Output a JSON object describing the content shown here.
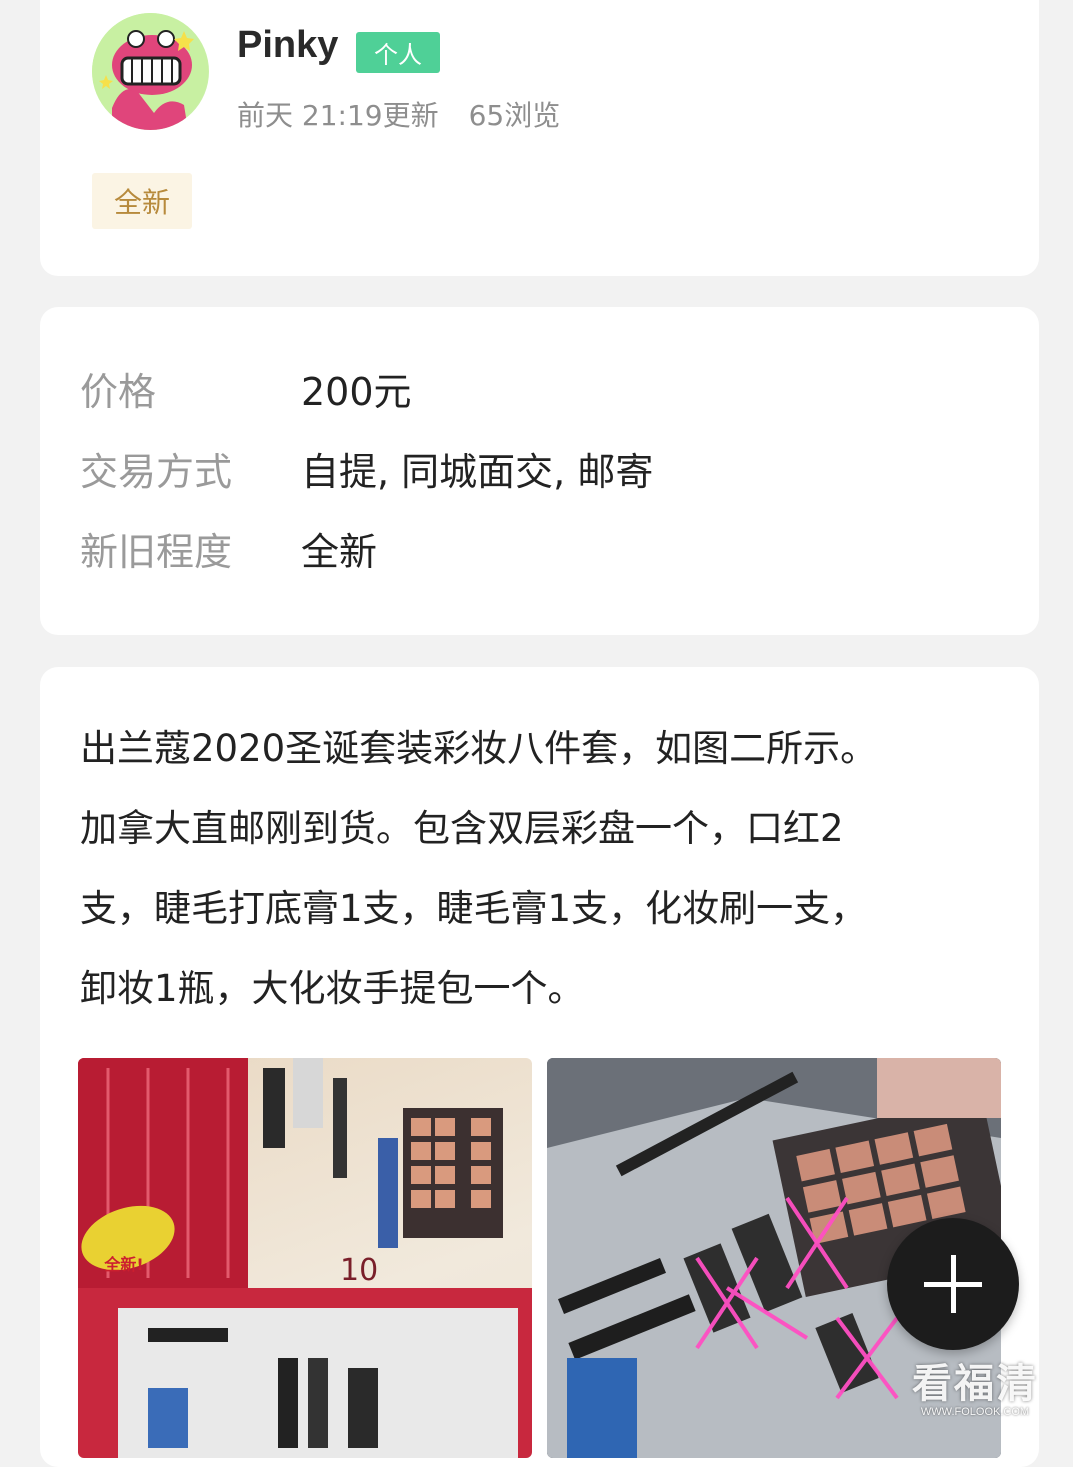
{
  "post": {
    "username": "Pinky",
    "seller_type": "个人",
    "updated": "前天 21:19更新",
    "views": "65浏览",
    "condition_tag": "全新"
  },
  "details": [
    {
      "label": "价格",
      "value": "200元"
    },
    {
      "label": "交易方式",
      "value": "自提, 同城面交, 邮寄"
    },
    {
      "label": "新旧程度",
      "value": "全新"
    }
  ],
  "description": [
    "出兰蔻2020圣诞套装彩妆八件套，如图二所示。",
    "加拿大直邮刚到货。包含双层彩盘一个，口红2",
    "支，睫毛打底膏1支，睫毛膏1支，化妆刷一支，",
    "卸妆1瓶，大化妆手提包一个。"
  ],
  "photo_1_sticker": "全新!",
  "photo_1_number": "10",
  "watermark": {
    "main": "看福清",
    "sub": "WWW.FOLOOK.COM"
  },
  "colors": {
    "badge_green": "#4fd097",
    "tag_bg": "#fbf4e4",
    "tag_text": "#b78a3c",
    "fab": "#1c1c1c"
  },
  "icons": {
    "fab": "plus-icon"
  }
}
